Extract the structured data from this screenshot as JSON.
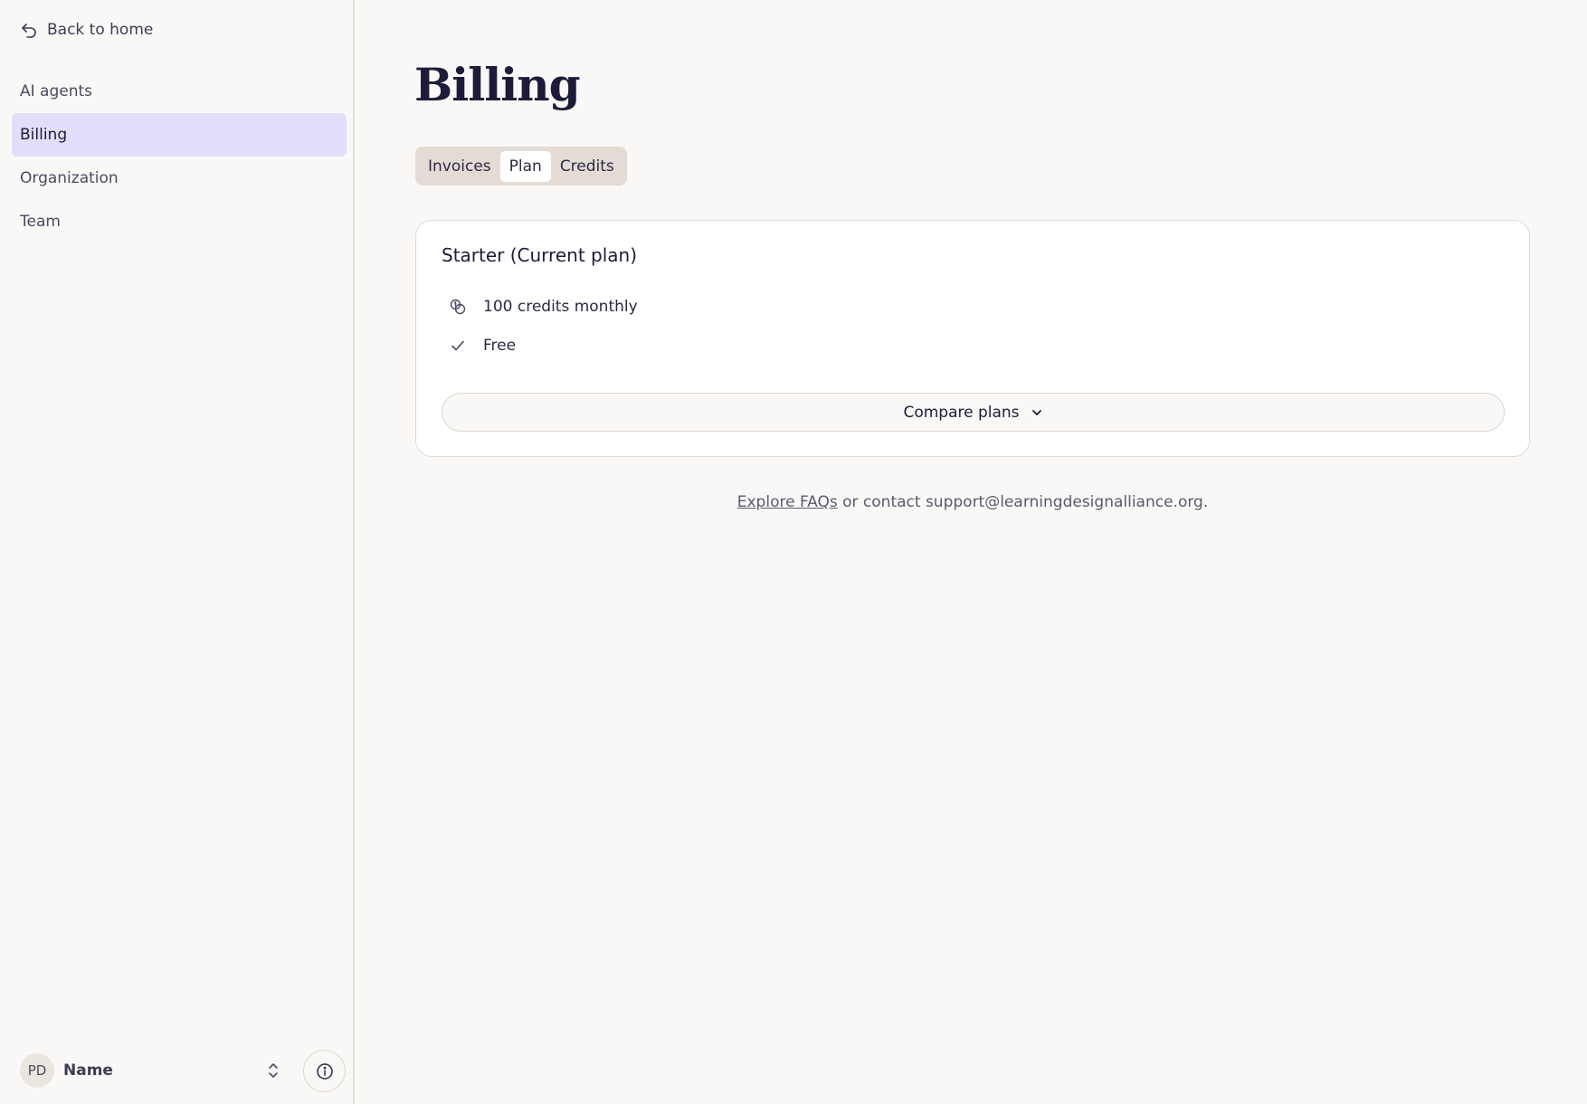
{
  "sidebar": {
    "back_label": "Back to home",
    "items": [
      {
        "label": "AI agents",
        "active": false
      },
      {
        "label": "Billing",
        "active": true
      },
      {
        "label": "Organization",
        "active": false
      },
      {
        "label": "Team",
        "active": false
      }
    ],
    "user": {
      "initials": "PD",
      "name": "Name"
    }
  },
  "main": {
    "title": "Billing",
    "tabs": [
      {
        "label": "Invoices",
        "active": false
      },
      {
        "label": "Plan",
        "active": true
      },
      {
        "label": "Credits",
        "active": false
      }
    ],
    "plan": {
      "title": "Starter (Current plan)",
      "features": [
        {
          "icon": "coins-icon",
          "label": "100 credits monthly"
        },
        {
          "icon": "check-icon",
          "label": "Free"
        }
      ],
      "compare_label": "Compare plans"
    },
    "footer": {
      "link_label": "Explore FAQs",
      "text": " or contact support@learningdesignalliance.org."
    }
  },
  "colors": {
    "background": "#f9f8f6",
    "active_nav": "#e2defa",
    "tabs_bg": "#e4dbd5",
    "text_dark": "#1c1c3a"
  }
}
